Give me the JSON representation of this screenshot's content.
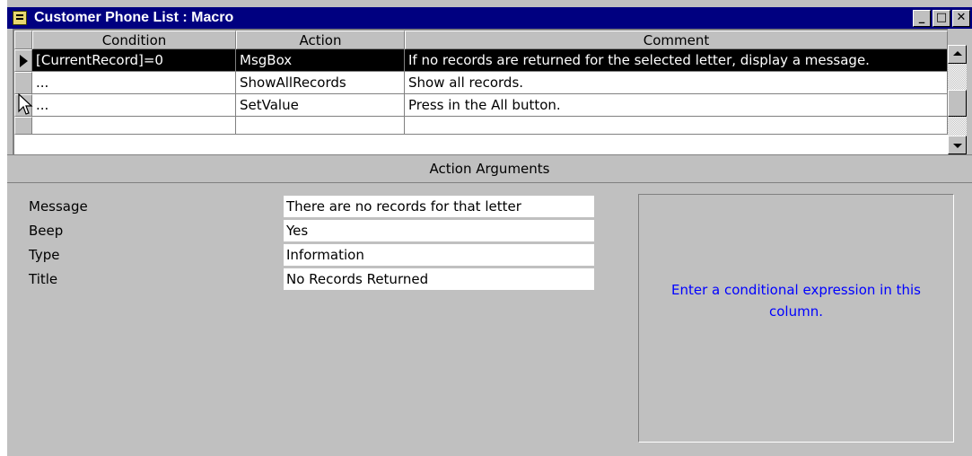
{
  "window": {
    "title": "Customer Phone List : Macro",
    "minimize": "_",
    "maximize": "□",
    "close": "✕"
  },
  "grid": {
    "columns": [
      "Condition",
      "Action",
      "Comment"
    ],
    "rows": [
      {
        "condition": "[CurrentRecord]=0",
        "action": "MsgBox",
        "comment": "If no records are returned for the selected letter, display a message."
      },
      {
        "condition": "...",
        "action": "ShowAllRecords",
        "comment": "Show all records."
      },
      {
        "condition": "...",
        "action": "SetValue",
        "comment": "Press in the All button."
      },
      {
        "condition": "",
        "action": "",
        "comment": ""
      }
    ]
  },
  "arguments": {
    "header": "Action Arguments",
    "items": [
      {
        "label": "Message",
        "value": "There are no records for that letter"
      },
      {
        "label": "Beep",
        "value": "Yes"
      },
      {
        "label": "Type",
        "value": "Information"
      },
      {
        "label": "Title",
        "value": "No Records Returned"
      }
    ],
    "help_text": "Enter a conditional expression in this column."
  },
  "colors": {
    "titlebar": "#000080",
    "face": "#c0c0c0",
    "help_text": "#0000ff",
    "selected_row": "#000000"
  }
}
